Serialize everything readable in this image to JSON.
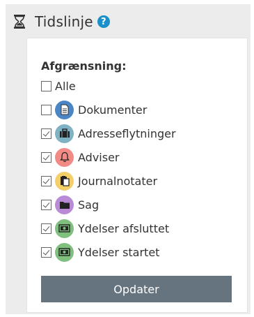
{
  "header": {
    "title": "Tidslinje",
    "icon": "hourglass-icon",
    "help_icon": "question-circle-icon"
  },
  "filter": {
    "label": "Afgrænsning:",
    "options": [
      {
        "label": "Alle",
        "checked": false,
        "icon": null
      },
      {
        "label": "Dokumenter",
        "checked": false,
        "icon": "document-icon",
        "icon_color": "#4a86c5"
      },
      {
        "label": "Adresseflytninger",
        "checked": true,
        "icon": "briefcase-icon",
        "icon_color": "#7fb2c3"
      },
      {
        "label": "Adviser",
        "checked": true,
        "icon": "bell-icon",
        "icon_color": "#f28b85"
      },
      {
        "label": "Journalnotater",
        "checked": true,
        "icon": "clipboard-icon",
        "icon_color": "#f3cf6a"
      },
      {
        "label": "Sag",
        "checked": true,
        "icon": "folder-icon",
        "icon_color": "#b98ad6"
      },
      {
        "label": "Ydelser afsluttet",
        "checked": true,
        "icon": "money-icon",
        "icon_color": "#7fc07f"
      },
      {
        "label": "Ydelser startet",
        "checked": true,
        "icon": "money-icon",
        "icon_color": "#7fc07f"
      }
    ]
  },
  "actions": {
    "update_label": "Opdater"
  }
}
